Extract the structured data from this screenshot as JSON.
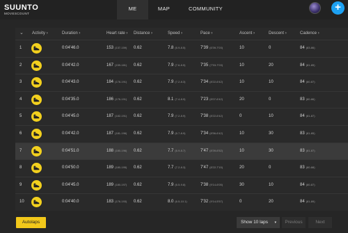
{
  "brand": {
    "name": "SUUNTO",
    "sub": "MOVESCOUNT"
  },
  "nav": {
    "me": "ME",
    "map": "MAP",
    "community": "COMMUNITY"
  },
  "header": {
    "chevron": "⌄",
    "activity": "Activity",
    "duration": "Duration",
    "heart_rate": "Heart rate",
    "distance": "Distance",
    "speed": "Speed",
    "pace": "Pace",
    "ascent": "Ascent",
    "descent": "Descent",
    "cadence": "Cadence"
  },
  "rows": [
    {
      "n": "1",
      "dur": "0:04'46.0",
      "hr": "153",
      "hr_r": "(137-159)",
      "dist": "0.62",
      "spd": "7.8",
      "spd_r": "(6.9-8.5)",
      "pace": "7'39",
      "pace_r": "(6'39-7'03)",
      "asc": "10",
      "desc": "0",
      "cad": "84",
      "cad_r": "(83-86)"
    },
    {
      "n": "2",
      "dur": "0:04'42.0",
      "hr": "167",
      "hr_r": "(159-181)",
      "dist": "0.62",
      "spd": "7.9",
      "spd_r": "(7.6-8.5)",
      "pace": "7'35",
      "pace_r": "(7'53-7'03)",
      "asc": "10",
      "desc": "20",
      "cad": "84",
      "cad_r": "(81-85)"
    },
    {
      "n": "3",
      "dur": "0:04'43.0",
      "hr": "184",
      "hr_r": "(178-191)",
      "dist": "0.62",
      "spd": "7.9",
      "spd_r": "(7.2-8.3)",
      "pace": "7'34",
      "pace_r": "(8'22-6'42)",
      "asc": "10",
      "desc": "10",
      "cad": "84",
      "cad_r": "(80-87)"
    },
    {
      "n": "4",
      "dur": "0:04'35.0",
      "hr": "186",
      "hr_r": "(176-191)",
      "dist": "0.62",
      "spd": "8.1",
      "spd_r": "(7.4-8.9)",
      "pace": "7'23",
      "pace_r": "(8'07-6'42)",
      "asc": "20",
      "desc": "0",
      "cad": "83",
      "cad_r": "(80-86)"
    },
    {
      "n": "5",
      "dur": "0:04'45.0",
      "hr": "187",
      "hr_r": "(182-191)",
      "dist": "0.62",
      "spd": "7.9",
      "spd_r": "(7.2-8.9)",
      "pace": "7'38",
      "pace_r": "(8'22-6'42)",
      "asc": "0",
      "desc": "10",
      "cad": "84",
      "cad_r": "(81-87)"
    },
    {
      "n": "6",
      "dur": "0:04'42.0",
      "hr": "187",
      "hr_r": "(181-196)",
      "dist": "0.62",
      "spd": "7.9",
      "spd_r": "(6.7-8.9)",
      "pace": "7'34",
      "pace_r": "(8'56-6'42)",
      "asc": "10",
      "desc": "30",
      "cad": "83",
      "cad_r": "(81-85)"
    },
    {
      "n": "7",
      "dur": "0:04'51.0",
      "hr": "188",
      "hr_r": "(180-196)",
      "dist": "0.62",
      "spd": "7.7",
      "spd_r": "(6.9-8.7)",
      "pace": "7'47",
      "pace_r": "(8'39-6'52)",
      "asc": "10",
      "desc": "30",
      "cad": "83",
      "cad_r": "(81-87)"
    },
    {
      "n": "8",
      "dur": "0:04'50.0",
      "hr": "189",
      "hr_r": "(180-195)",
      "dist": "0.62",
      "spd": "7.7",
      "spd_r": "(7.2-8.3)",
      "pace": "7'47",
      "pace_r": "(8'22-7'15)",
      "asc": "20",
      "desc": "0",
      "cad": "83",
      "cad_r": "(80-88)"
    },
    {
      "n": "9",
      "dur": "0:04'45.0",
      "hr": "189",
      "hr_r": "(180-197)",
      "dist": "0.62",
      "spd": "7.9",
      "spd_r": "(6.5-9.8)",
      "pace": "7'38",
      "pace_r": "(9'14-6'05)",
      "asc": "30",
      "desc": "10",
      "cad": "84",
      "cad_r": "(80-87)"
    },
    {
      "n": "10",
      "dur": "0:04'40.0",
      "hr": "183",
      "hr_r": "(176-193)",
      "dist": "0.62",
      "spd": "8.0",
      "spd_r": "(6.5-10.1)",
      "pace": "7'32",
      "pace_r": "(9'14-5'57)",
      "asc": "0",
      "desc": "20",
      "cad": "84",
      "cad_r": "(81-89)"
    }
  ],
  "footer": {
    "autolaps": "Autolaps",
    "show": "Show 10 laps",
    "caret": "▾",
    "prev": "Previous",
    "next": "Next"
  },
  "colors": {
    "accent": "#f2c81a",
    "add_button": "#1da1f2",
    "background": "#262626"
  },
  "icons": {
    "activity": "running-shoe-icon",
    "add": "plus-icon",
    "sort": "chevron-right-icon"
  }
}
